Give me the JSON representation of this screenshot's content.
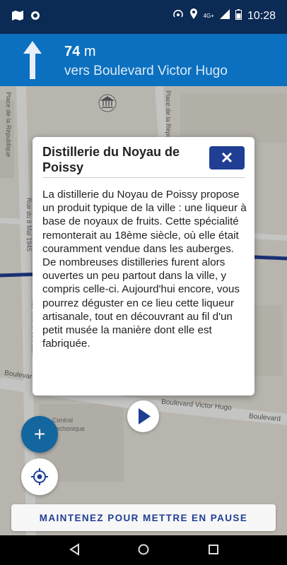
{
  "status_bar": {
    "time": "10:28",
    "network_label": "4G+"
  },
  "navigation": {
    "distance_value": "74",
    "distance_unit": "m",
    "street": "vers Boulevard Victor Hugo"
  },
  "map_labels": {
    "street_left_top": "Place de la République",
    "street_right_top": "Place de la République",
    "street_left_mid": "Rue du 8 Mai 1945",
    "street_left_lower": "Rue Michel Jourdain",
    "boulevard_left": "Boulevard",
    "boulevard_center": "Boulevard Victor Hugo",
    "boulevard_right": "Boulevard",
    "area_label_1": "Central",
    "area_label_2": "Techonique"
  },
  "modal": {
    "title": "Distillerie du Noyau de Poissy",
    "close_label": "✕",
    "body": "La distillerie du Noyau de Poissy propose un produit typique de la ville : une liqueur à base de noyaux de fruits. Cette spécialité remonterait au 18ème siècle, où elle était couramment vendue dans les auberges. De nombreuses distilleries furent alors ouvertes un peu partout dans la ville, y compris celle-ci. Aujourd'hui encore, vous pourrez déguster en ce lieu cette liqueur artisanale, tout en découvrant au fil d'un petit musée la manière dont elle est fabriquée."
  },
  "controls": {
    "add_label": "+",
    "pause_label": "MAINTENEZ POUR METTRE EN PAUSE"
  },
  "colors": {
    "status_bar": "#0b2a54",
    "nav_banner": "#0b70bf",
    "accent": "#1f3e94",
    "fab": "#14669f"
  }
}
